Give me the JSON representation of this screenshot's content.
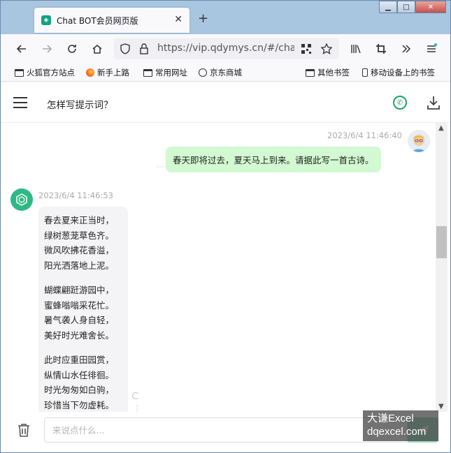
{
  "browser": {
    "tab_title": "Chat BOT会员网页版",
    "url": "https://vip.qdymys.cn/#/chat/",
    "bookmarks": [
      "火狐官方站点",
      "新手上路",
      "常用网址",
      "京东商城",
      "其他书签",
      "移动设备上的书签"
    ]
  },
  "header": {
    "title": "怎样写提示词？"
  },
  "messages": {
    "user": {
      "timestamp": "2023/6/4 11:46:40",
      "text": "春天即将过去，夏天马上到来。请据此写一首古诗。"
    },
    "bot": {
      "timestamp": "2023/6/4 11:46:53",
      "stanzas": [
        [
          "春去夏来正当时，",
          "绿树葱茏草色齐。",
          "微风吹拂花香溢，",
          "阳光洒落地上泥。"
        ],
        [
          "蝴蝶翩跹游园中，",
          "蜜蜂嗡嗡采花忙。",
          "暑气袭人身自轻，",
          "美好时光难舍长。"
        ],
        [
          "此时应重田园赏，",
          "纵情山水任徘徊。",
          "时光匆匆如白驹，",
          "珍惜当下勿虚耗。"
        ]
      ]
    }
  },
  "input": {
    "placeholder": "来说点什么..."
  },
  "watermark": {
    "line1": "大谦Excel",
    "line2": "dqexcel.com"
  },
  "colors": {
    "accent": "#10a37f",
    "user_bubble": "#d2f9d1",
    "bot_bubble": "#f4f4f6"
  }
}
